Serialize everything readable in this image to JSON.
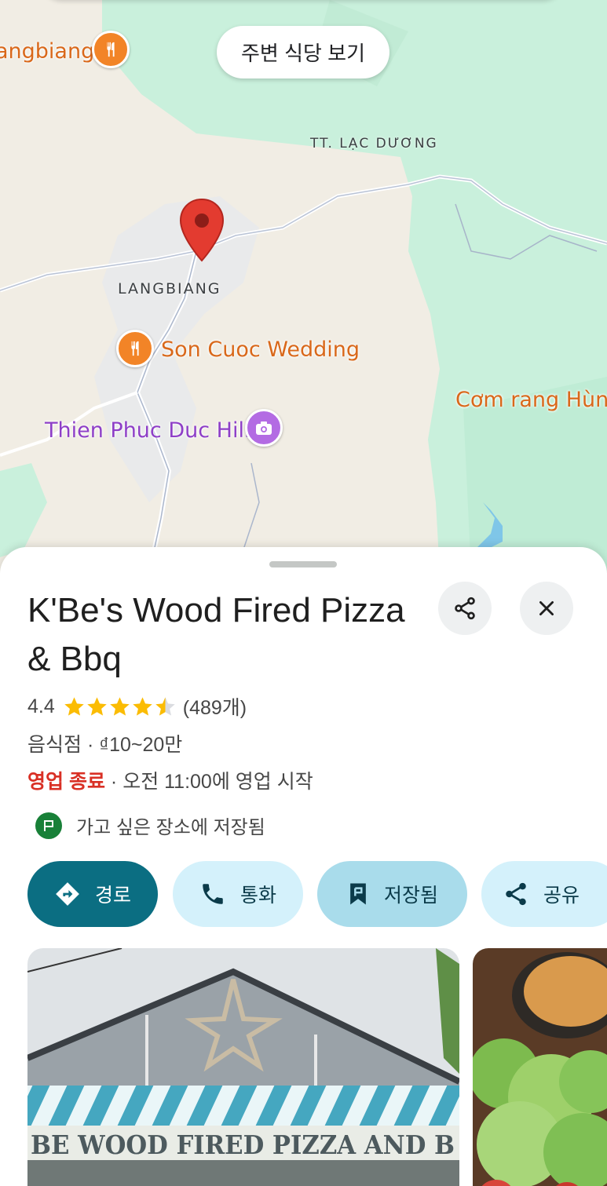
{
  "map": {
    "nearby_restaurants_chip": "주변 식당 보기",
    "labels": {
      "langbiang_top": "angbiang",
      "tt_lac_duong": "TT. LẠC DƯƠNG",
      "langbiang": "LANGBIANG",
      "son_cuoc_wedding": "Son Cuoc Wedding",
      "com_rang_hung": "Cơm rang Hùng",
      "thien_phuc_duc_hill": "Thien Phuc Duc Hill"
    },
    "colors": {
      "poi_orange": "#f28427",
      "poi_purple": "#b36be3",
      "pin_red": "#d93025"
    }
  },
  "place": {
    "name": "K'Be's Wood Fired Pizza & Bbq",
    "rating": "4.4",
    "rating_value": 4.4,
    "review_count": "(489개)",
    "category": "음식점",
    "price": "₫10~20만",
    "status_closed": "영업 종료",
    "opening_info": "오전 11:00에 영업 시작",
    "saved_note": "가고 싶은 장소에 저장됨"
  },
  "actions": {
    "directions": "경로",
    "call": "통화",
    "saved": "저장됨",
    "share": "공유"
  },
  "photos": {
    "sign_text": "BE WOOD FIRED PIZZA AND B"
  }
}
